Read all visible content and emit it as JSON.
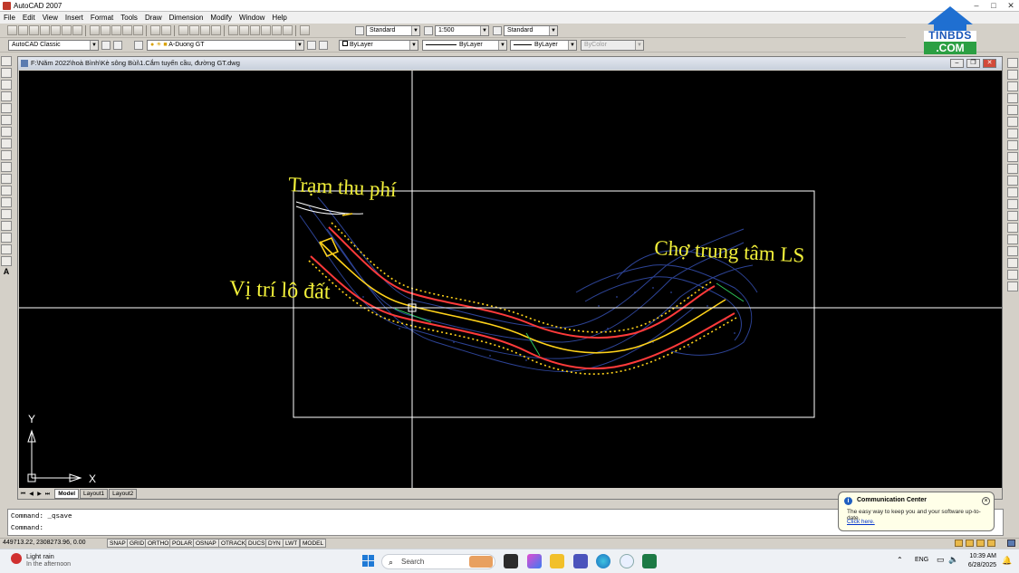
{
  "window": {
    "title": "AutoCAD 2007",
    "min": "–",
    "max": "□",
    "close": "✕"
  },
  "menu": [
    "File",
    "Edit",
    "View",
    "Insert",
    "Format",
    "Tools",
    "Draw",
    "Dimension",
    "Modify",
    "Window",
    "Help"
  ],
  "toolbars": {
    "text_style": "Standard",
    "dim_scale": "1:500",
    "table_style": "Standard",
    "workspace": "AutoCAD Classic",
    "layer": "A-Duong GT",
    "color": "ByLayer",
    "linetype": "ByLayer",
    "lineweight": "ByLayer",
    "plotstyle": "ByColor"
  },
  "document": {
    "path": "F:\\Năm 2022\\hoà Bình\\Kè sông Bùi\\1.Cắm tuyến cầu, đường GT.dwg"
  },
  "drawing": {
    "annotations": {
      "toll_station": "Trạm thu phí",
      "land_plot": "Vị trí lô đất",
      "central_market": "Chợ trung tâm LS"
    },
    "ucs": {
      "y_label": "Y",
      "x_label": "X"
    },
    "colors": {
      "annotation_text": "#f2f03a",
      "road_edge": "#ff3a3a",
      "road_center": "#ffd21a",
      "terrain": "#4a6ad0",
      "crosshair": "#ffffff"
    }
  },
  "tabs": {
    "nav": [
      "⏮",
      "◀",
      "▶",
      "⏭"
    ],
    "model": "Model",
    "layout1": "Layout1",
    "layout2": "Layout2"
  },
  "command": {
    "line1": "Command: _qsave",
    "line2": "Command:"
  },
  "status": {
    "coordinates": "449713.22, 2308273.96, 0.00",
    "toggles": [
      "SNAP",
      "GRID",
      "ORTHO",
      "POLAR",
      "OSNAP",
      "OTRACK",
      "DUCS",
      "DYN",
      "LWT",
      "MODEL"
    ]
  },
  "comm_center": {
    "title": "Communication Center",
    "message": "The easy way to keep you and your software up-to-date.",
    "link": "Click here."
  },
  "taskbar": {
    "weather_main": "Light rain",
    "weather_sub": "In the afternoon",
    "search_placeholder": "Search",
    "language": "ENG",
    "time": "10:39 AM",
    "date": "6/28/2025"
  },
  "watermark": {
    "line1": "TINBDS",
    "line2": ".COM"
  }
}
